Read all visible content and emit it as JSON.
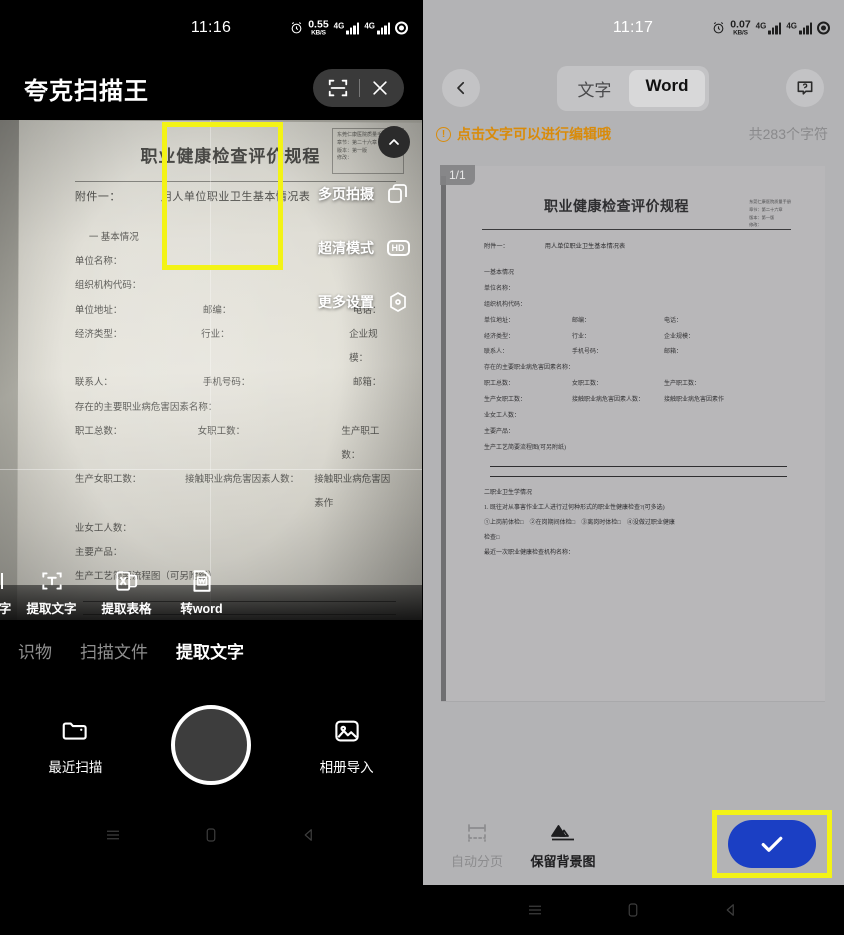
{
  "left": {
    "status": {
      "time": "11:16",
      "net_speed_value": "0.55",
      "net_speed_unit": "KB/S",
      "sim1": "4G",
      "sim2": "4G"
    },
    "app_title": "夸克扫描王",
    "header_icons": {
      "scan": "scan-frame-icon",
      "close": "close-icon"
    },
    "camera_controls": [
      {
        "label": "多页拍摄",
        "icon": "multi-page-icon"
      },
      {
        "label": "超清模式",
        "icon": "hd-icon"
      },
      {
        "label": "更多设置",
        "icon": "settings-gear-icon"
      }
    ],
    "collapse_icon": "chevron-up-icon",
    "function_strip": [
      {
        "label": "字",
        "icon": "partial-icon",
        "highlighted": false
      },
      {
        "label": "提取文字",
        "icon": "extract-text-icon",
        "highlighted": false
      },
      {
        "label": "提取表格",
        "icon": "extract-table-icon",
        "highlighted": false
      },
      {
        "label": "转word",
        "icon": "to-word-icon",
        "highlighted": true
      }
    ],
    "mode_tabs": [
      {
        "label": "识物",
        "active": false
      },
      {
        "label": "扫描文件",
        "active": false
      },
      {
        "label": "提取文字",
        "active": true
      }
    ],
    "bottom": {
      "recent_label": "最近扫描",
      "recent_icon": "folder-icon",
      "shutter_name": "shutter-button",
      "album_label": "相册导入",
      "album_icon": "photo-icon"
    },
    "doc_preview": {
      "title": "职业健康检查评价规程",
      "stamp": [
        "东莞仁康医院质量手册",
        "章节：第二十六章",
        "版本：第一版",
        "修改："
      ],
      "attachment_label": "附件一：",
      "attachment_title": "用人单位职业卫生基本情况表",
      "section1": "一  基本情况",
      "fields": [
        [
          "单位名称："
        ],
        [
          "组织机构代码："
        ],
        [
          "单位地址：",
          "邮编：",
          "电话："
        ],
        [
          "经济类型：",
          "行业：",
          "企业规模："
        ],
        [
          "联系人：",
          "手机号码：",
          "邮箱："
        ],
        [
          "存在的主要职业病危害因素名称："
        ],
        [
          "职工总数：",
          "女职工数：",
          "生产职工数："
        ],
        [
          "生产女职工数：",
          "接触职业病危害因素人数：",
          "接触职业病危害因素作"
        ],
        [
          "业女工人数："
        ],
        [
          "主要产品："
        ],
        [
          "生产工艺简要流程图（可另附纸）"
        ]
      ],
      "section2": "二  职业卫生学情况",
      "q1": "1、既往对从事有害作业工人进行过何种形式的职业性健康检查？（可多选）",
      "q1_options": "①上岗前体检□　②在岗期间体检□　③离岗时体检□　④没做过职业健康",
      "q1_cont": "检查□",
      "q2": "最近一次职业健康检查机构名称："
    },
    "navbar": [
      "menu-icon",
      "home-icon",
      "back-icon"
    ]
  },
  "right": {
    "status": {
      "time": "11:17",
      "net_speed_value": "0.07",
      "net_speed_unit": "KB/S",
      "sim1": "4G",
      "sim2": "4G"
    },
    "back_icon": "chevron-left-icon",
    "help_icon": "help-icon",
    "tabs": [
      {
        "label": "文字",
        "active": false
      },
      {
        "label": "Word",
        "active": true
      }
    ],
    "hint": "点击文字可以进行编辑哦",
    "char_count": "共283个字符",
    "page_badge": "1/1",
    "bottom_actions": [
      {
        "label": "自动分页",
        "icon": "auto-split-icon",
        "disabled": true
      },
      {
        "label": "保留背景图",
        "icon": "keep-background-icon",
        "disabled": false
      }
    ],
    "confirm": {
      "icon": "check-icon",
      "color": "#1b3fc4",
      "highlighted": true
    },
    "doc_preview": {
      "title": "职业健康检查评价规程",
      "stamp": [
        "东莞仁康医院质量手册",
        "章节：第二十六章",
        "版本：第一版",
        "修改："
      ],
      "attachment_label": "附件一：",
      "attachment_title": "用人单位职业卫生基本情况表",
      "section1": "一基本情况",
      "fields": [
        [
          "单位名称："
        ],
        [
          "组织机构代码："
        ],
        [
          "单位地址：",
          "邮编：",
          "电话："
        ],
        [
          "经济类型：",
          "行业：",
          "企业规模："
        ],
        [
          "联系人：",
          "手机号码：",
          "邮箱："
        ],
        [
          "存在的主要职业病危害因素名称："
        ],
        [
          "职工总数：",
          "女职工数：",
          "生产职工数："
        ],
        [
          "生产女职工数：",
          "接触职业病危害因素人数：",
          "接触职业病危害因素作"
        ],
        [
          "业女工人数："
        ],
        [
          "主要产品："
        ],
        [
          "生产工艺简要流程图(可另附纸)"
        ]
      ],
      "section2": "二职业卫生学情况",
      "q1": "1. 既往对从事害作业工人进行过何种形式的职业性健康检查?(可多选)",
      "q1_options": "①上岗前体检□　②在岗期间体检□　③离岗时体检□　④没做过职业健康",
      "q1_cont": "检查□",
      "q2": "最近一次职业健康检查机构名称："
    },
    "navbar": [
      "menu-icon",
      "home-icon",
      "back-icon"
    ]
  },
  "highlights": {
    "color": "#f3f316",
    "left_box_name": "extract-text-highlight",
    "right_box_name": "confirm-button-highlight"
  }
}
